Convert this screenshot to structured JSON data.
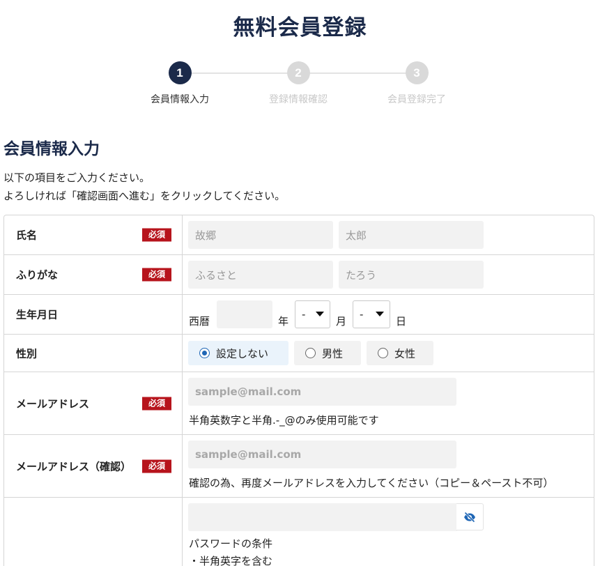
{
  "page": {
    "title": "無料会員登録"
  },
  "stepper": {
    "steps": [
      {
        "number": "1",
        "label": "会員情報入力"
      },
      {
        "number": "2",
        "label": "登録情報確認"
      },
      {
        "number": "3",
        "label": "会員登録完了"
      }
    ],
    "active_step": 1
  },
  "section": {
    "title": "会員情報入力",
    "intro_line1": "以下の項目をご入力ください。",
    "intro_line2": "よろしければ「確認画面へ進む」をクリックしてください。"
  },
  "required_badge": "必須",
  "form": {
    "name": {
      "label": "氏名",
      "last_placeholder": "故郷",
      "first_placeholder": "太郎"
    },
    "furigana": {
      "label": "ふりがな",
      "last_placeholder": "ふるさと",
      "first_placeholder": "たろう"
    },
    "birthdate": {
      "label": "生年月日",
      "era_prefix": "西暦",
      "year_suffix": "年",
      "month_value": "-",
      "month_suffix": "月",
      "day_value": "-",
      "day_suffix": "日"
    },
    "gender": {
      "label": "性別",
      "options": [
        "設定しない",
        "男性",
        "女性"
      ],
      "selected": "設定しない"
    },
    "email": {
      "label": "メールアドレス",
      "placeholder": "sample@mail.com",
      "note": "半角英数字と半角.-_@のみ使用可能です"
    },
    "email_confirm": {
      "label": "メールアドレス（確認）",
      "placeholder": "sample@mail.com",
      "note": "確認の為、再度メールアドレスを入力してください（コピー＆ペースト不可）"
    },
    "password": {
      "value": "",
      "conditions_title": "パスワードの条件",
      "condition_1": "・半角英字を含む",
      "toggle_icon": "eye-off-icon"
    }
  },
  "colors": {
    "navy": "#1b2a4a",
    "required": "#b7141c",
    "radio_accent": "#1f66b5",
    "eye_icon": "#1f66b5"
  }
}
